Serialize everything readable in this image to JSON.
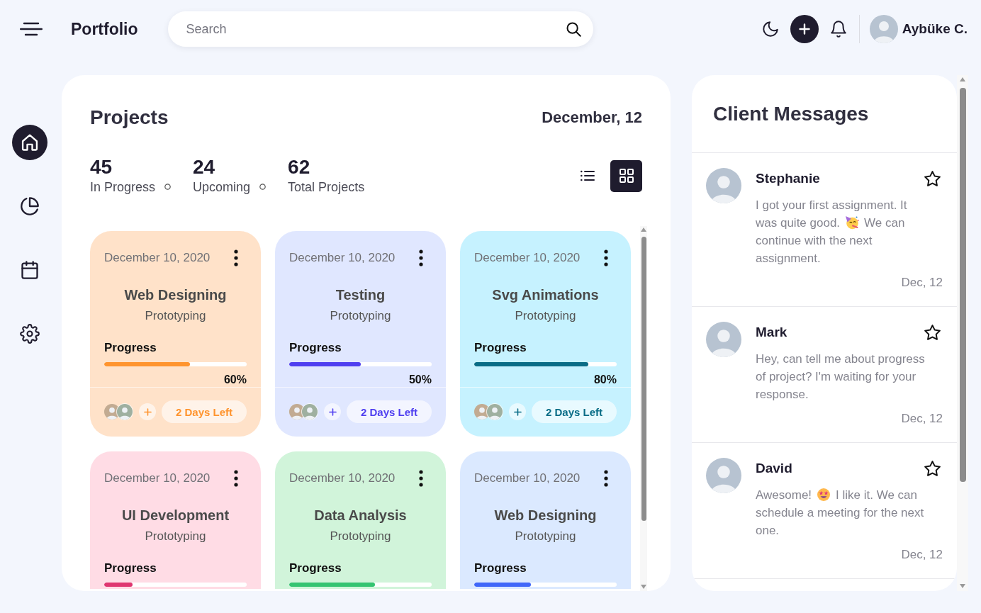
{
  "header": {
    "title": "Portfolio",
    "search": {
      "placeholder": "Search"
    },
    "user": {
      "name": "Aybüke C."
    }
  },
  "sidebar": {
    "items": [
      {
        "kind": "home",
        "selected": true
      },
      {
        "kind": "chart",
        "selected": false
      },
      {
        "kind": "calendar",
        "selected": false
      },
      {
        "kind": "settings",
        "selected": false
      }
    ]
  },
  "projects": {
    "title": "Projects",
    "date": "December, 12",
    "stats": [
      {
        "value": "45",
        "label": "In Progress"
      },
      {
        "value": "24",
        "label": "Upcoming"
      },
      {
        "value": "62",
        "label": "Total Projects"
      }
    ],
    "view_modes": [
      {
        "kind": "list",
        "selected": false
      },
      {
        "kind": "grid",
        "selected": true
      }
    ],
    "cards": [
      {
        "date": "December 10, 2020",
        "title": "Web Designing",
        "subtitle": "Prototyping",
        "progress_label": "Progress",
        "level": 0.6,
        "percent": "60%",
        "days_left": "2 Days Left",
        "color": "#ff942e"
      },
      {
        "date": "December 10, 2020",
        "title": "Testing",
        "subtitle": "Prototyping",
        "progress_label": "Progress",
        "level": 0.5,
        "percent": "50%",
        "days_left": "2 Days Left",
        "color": "#4f3ff0"
      },
      {
        "date": "December 10, 2020",
        "title": "Svg Animations",
        "subtitle": "Prototyping",
        "progress_label": "Progress",
        "level": 0.8,
        "percent": "80%",
        "days_left": "2 Days Left",
        "color": "#096c86"
      },
      {
        "date": "December 10, 2020",
        "title": "UI Development",
        "subtitle": "Prototyping",
        "progress_label": "Progress",
        "level": 0.2,
        "color": "#df3670"
      },
      {
        "date": "December 10, 2020",
        "title": "Data Analysis",
        "subtitle": "Prototyping",
        "progress_label": "Progress",
        "level": 0.6,
        "color": "#34c471"
      },
      {
        "date": "December 10, 2020",
        "title": "Web Designing",
        "subtitle": "Prototyping",
        "progress_label": "Progress",
        "level": 0.4,
        "color": "#4067f9"
      }
    ]
  },
  "messages": {
    "title": "Client Messages",
    "items": [
      {
        "name": "Stephanie",
        "starred": false,
        "body": [
          {
            "kind": "text",
            "text": "I got your first assignment. It was quite good."
          },
          {
            "kind": "party"
          },
          {
            "kind": "text",
            "text": "We can continue with the next assignment."
          }
        ],
        "date": "Dec, 12"
      },
      {
        "name": "Mark",
        "starred": false,
        "body": [
          {
            "kind": "text",
            "text": "Hey, can tell me about progress of project? I'm waiting for your response."
          }
        ],
        "date": "Dec, 12"
      },
      {
        "name": "David",
        "starred": false,
        "body": [
          {
            "kind": "text",
            "text": "Awesome!"
          },
          {
            "kind": "starstruck"
          },
          {
            "kind": "text",
            "text": "I like it. We can schedule a meeting for the next one."
          }
        ],
        "date": "Dec, 12"
      }
    ]
  }
}
